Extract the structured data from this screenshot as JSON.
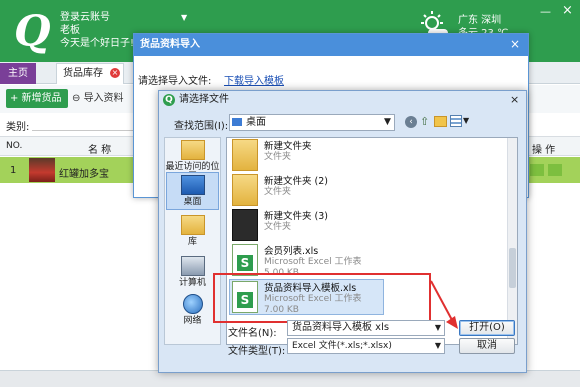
{
  "header": {
    "user_line1": "登录云账号",
    "user_line2": "老板",
    "user_line3": "今天是个好日子!",
    "city": "广东 深圳",
    "weather": "多云 23 ℃",
    "min_icon": "minimize-icon",
    "close_icon": "close-icon"
  },
  "tabs": [
    {
      "label": "主页"
    },
    {
      "label": "货品库存"
    }
  ],
  "toolbar": {
    "new_label": "+ 新增货品",
    "import_label": "导入资料",
    "category_label": "类别:"
  },
  "grid": {
    "columns": [
      "NO.",
      "名 称",
      "操 作"
    ],
    "rows": [
      {
        "no": "1",
        "name": "红罐加多宝"
      }
    ]
  },
  "import_dialog": {
    "title": "货品资料导入",
    "choose_label": "请选择导入文件:",
    "template_link": "下载导入模板",
    "close": "×"
  },
  "file_dialog": {
    "title": "请选择文件",
    "lookin_label": "查找范围(I):",
    "lookin_value": "桌面",
    "places": [
      {
        "label": "最近访问的位置",
        "icon": "recent-places-icon"
      },
      {
        "label": "桌面",
        "icon": "desktop-icon"
      },
      {
        "label": "库",
        "icon": "libraries-icon"
      },
      {
        "label": "计算机",
        "icon": "computer-icon"
      },
      {
        "label": "网络",
        "icon": "network-icon"
      }
    ],
    "files": [
      {
        "name": "新建文件夹",
        "type": "文件夹",
        "size": ""
      },
      {
        "name": "新建文件夹 (2)",
        "type": "文件夹",
        "size": ""
      },
      {
        "name": "新建文件夹 (3)",
        "type": "文件夹",
        "size": ""
      },
      {
        "name": "会员列表.xls",
        "type": "Microsoft Excel 工作表",
        "size": "5.00 KB"
      },
      {
        "name": "货品资料导入模板.xls",
        "type": "Microsoft Excel 工作表",
        "size": "7.00 KB"
      }
    ],
    "filename_label": "文件名(N):",
    "filename_value": "货品资料导入模板 xls",
    "filetype_label": "文件类型(T):",
    "filetype_value": "Excel 文件(*.xls;*.xlsx)",
    "open_label": "打开(O)",
    "cancel_label": "取消"
  },
  "colors": {
    "brand_green": "#2e9d4e",
    "dialog_blue": "#4a8fdb",
    "highlight_red": "#e03030",
    "row_selected": "#a3d25a"
  }
}
